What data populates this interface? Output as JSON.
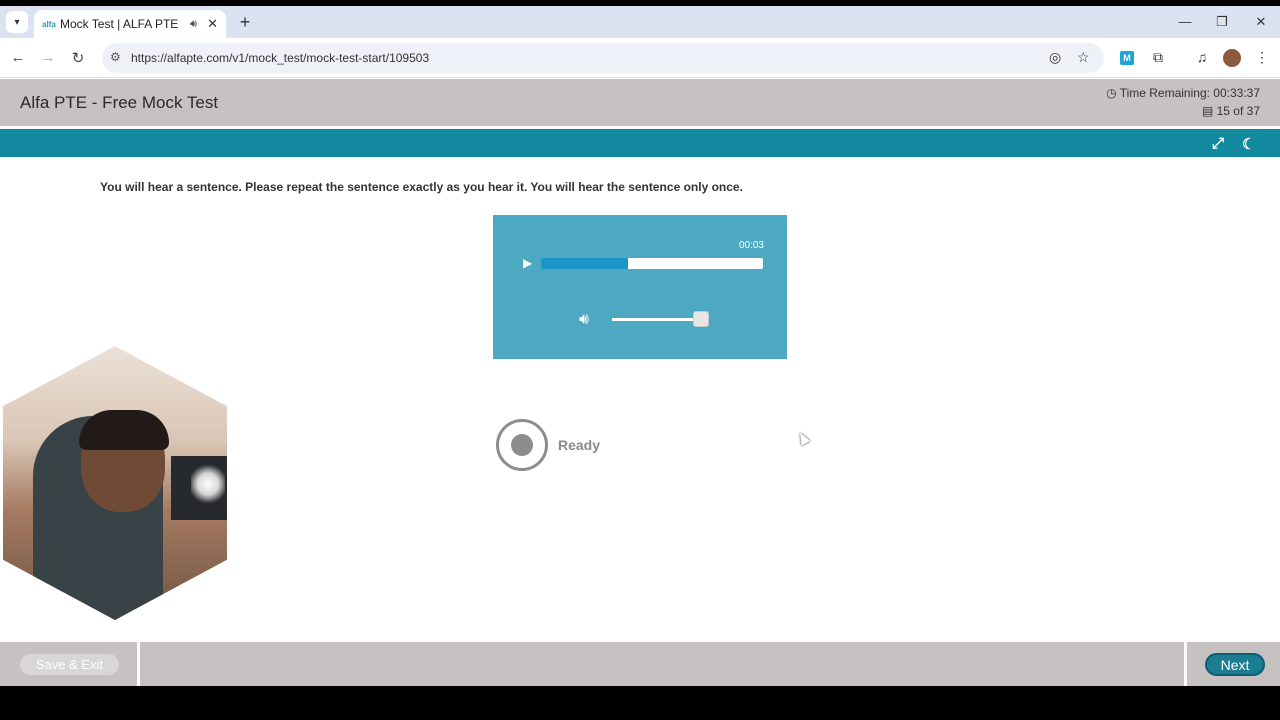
{
  "browser": {
    "tab_title": "Mock Test | ALFA PTE",
    "favicon_text": "alfa",
    "url": "https://alfapte.com/v1/mock_test/mock-test-start/109503",
    "extension_badge": "M"
  },
  "header": {
    "title": "Alfa PTE - Free Mock Test",
    "time_remaining": "Time Remaining: 00:33:37",
    "question_counter": "15 of 37"
  },
  "instruction": "You will hear a sentence. Please repeat the sentence exactly as you hear it. You will hear the sentence only once.",
  "audio_player": {
    "time": "00:03",
    "progress_fraction": 0.39,
    "volume_fraction": 0.97
  },
  "recorder": {
    "status": "Ready"
  },
  "footer": {
    "save_exit_label": "Save & Exit",
    "next_label": "Next"
  },
  "colors": {
    "teal_bar": "#118a9d",
    "player_bg": "#4da8c1",
    "progress_fill": "#1a97c6",
    "next_button": "#1a7d91",
    "header_gray": "#c6c2c2"
  }
}
